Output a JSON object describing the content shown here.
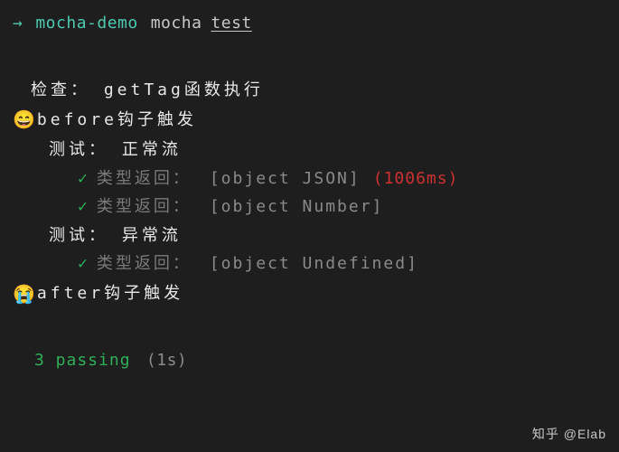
{
  "prompt": {
    "arrow": "→",
    "cwd": "mocha-demo",
    "cmd": "mocha",
    "arg": "test"
  },
  "suite": {
    "root": "检查： getTag函数执行",
    "before": {
      "emoji": "😄",
      "text": "before钩子触发"
    },
    "sub1": {
      "title": "测试： 正常流",
      "tests": [
        {
          "check": "✓",
          "label": "类型返回：",
          "value": "[object JSON]",
          "timing": "(1006ms)"
        },
        {
          "check": "✓",
          "label": "类型返回：",
          "value": "[object Number]",
          "timing": ""
        }
      ]
    },
    "sub2": {
      "title": "测试： 异常流",
      "tests": [
        {
          "check": "✓",
          "label": "类型返回：",
          "value": "[object Undefined]",
          "timing": ""
        }
      ]
    },
    "after": {
      "emoji": "😭",
      "text": "after钩子触发"
    }
  },
  "summary": {
    "passing": "3 passing",
    "duration": "(1s)"
  },
  "watermark": "知乎 @Elab"
}
